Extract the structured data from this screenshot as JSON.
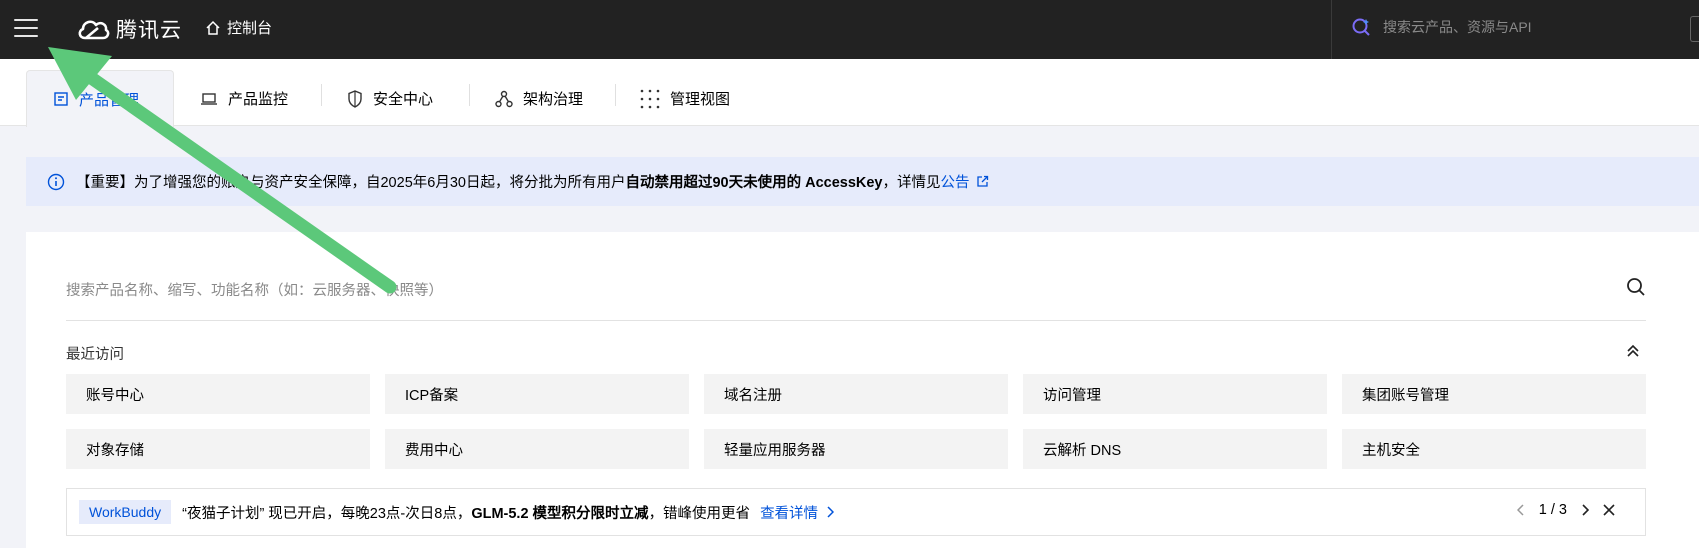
{
  "topbar": {
    "logo_text": "腾讯云",
    "console_label": "控制台",
    "search_placeholder": "搜索云产品、资源与API"
  },
  "tabs": [
    {
      "label": "产品管理",
      "icon": "product-icon",
      "active": true
    },
    {
      "label": "产品监控",
      "icon": "monitor-icon"
    },
    {
      "label": "安全中心",
      "icon": "shield-icon"
    },
    {
      "label": "架构治理",
      "icon": "architecture-icon"
    },
    {
      "label": "管理视图",
      "icon": "grid-dots-icon"
    }
  ],
  "notice": {
    "prefix": "【重要】为了增强您的账户与资产安全保障，自2025年6月30日起，将分批为所有用户",
    "bold": "自动禁用超过90天未使用的 AccessKey",
    "suffix": "，详情见",
    "link": "公告"
  },
  "search": {
    "placeholder": "搜索产品名称、缩写、功能名称（如：云服务器、快照等）"
  },
  "recent": {
    "title": "最近访问",
    "items": [
      "账号中心",
      "ICP备案",
      "域名注册",
      "访问管理",
      "集团账号管理",
      "对象存储",
      "费用中心",
      "轻量应用服务器",
      "云解析 DNS",
      "主机安全"
    ]
  },
  "promo": {
    "tag": "WorkBuddy",
    "text1": "“夜猫子计划” 现已开启，每晚23点-次日8点，",
    "bold": "GLM-5.2 模型积分限时立减",
    "text2": "，错峰使用更省",
    "detail": "查看详情",
    "page": "1 / 3"
  },
  "colors": {
    "topbar_bg": "#222222",
    "accent": "#0052d9",
    "annotation_arrow": "#5cc87a"
  }
}
